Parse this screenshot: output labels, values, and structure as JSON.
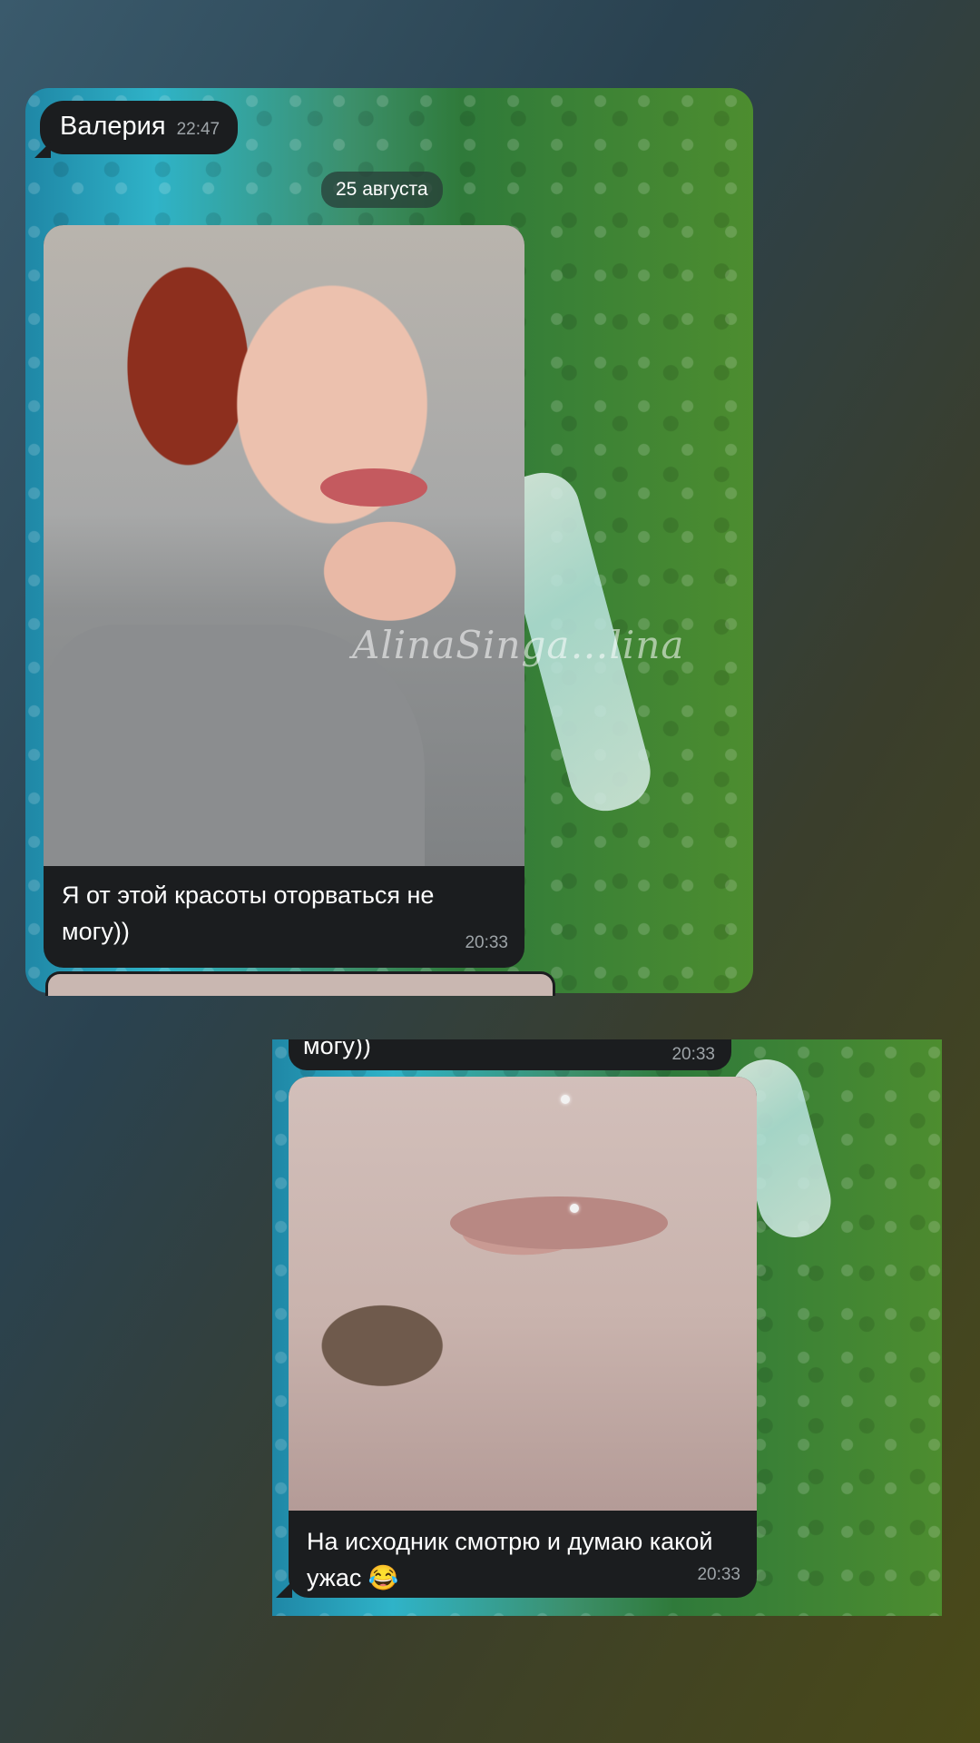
{
  "chat": {
    "sender_name": "Валерия",
    "sender_time": "22:47",
    "date_separator": "25 августа"
  },
  "messages": [
    {
      "caption": "Я от этой красоты оторваться не могу))",
      "time": "20:33",
      "has_photo": true,
      "watermark": "AlinaSinga…lina"
    },
    {
      "caption_fragment": "могу))",
      "time": "20:33"
    },
    {
      "caption": "На исходник смотрю и думаю какой ужас 😂",
      "time": "20:33",
      "has_photo": true
    }
  ],
  "colors": {
    "bubble": "#1b1d1f",
    "time_text": "#9ea4a8",
    "background_start": "#3a5a6c",
    "background_end": "#4a4a18"
  }
}
